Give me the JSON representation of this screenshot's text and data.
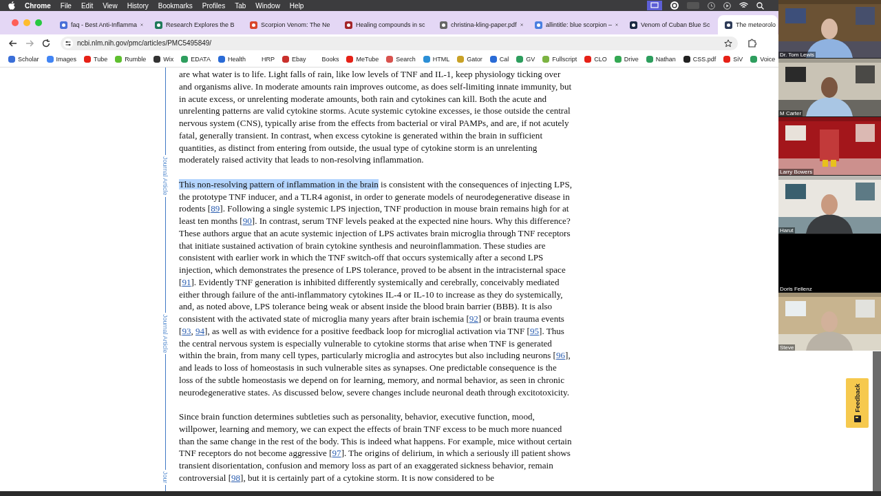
{
  "menu_bar": {
    "app": "Chrome",
    "items": [
      "File",
      "Edit",
      "View",
      "History",
      "Bookmarks",
      "Profiles",
      "Tab",
      "Window",
      "Help"
    ]
  },
  "tabs": [
    {
      "title": "faq - Best Anti-Inflamma",
      "selected": false
    },
    {
      "title": "Research Explores the B",
      "selected": false
    },
    {
      "title": "Scorpion Venom: The Ne",
      "selected": false
    },
    {
      "title": "Healing compounds in sc",
      "selected": false
    },
    {
      "title": "christina-kling-paper.pdf",
      "selected": false
    },
    {
      "title": "allintitle: blue scorpion –",
      "selected": false
    },
    {
      "title": "Venom of Cuban Blue Sc",
      "selected": false
    },
    {
      "title": "The meteorolo",
      "selected": true
    }
  ],
  "address_bar": {
    "url": "ncbi.nlm.nih.gov/pmc/articles/PMC5495849/"
  },
  "bookmarks": [
    {
      "label": "Scholar",
      "kind": "icon"
    },
    {
      "label": "Images",
      "kind": "icon"
    },
    {
      "label": "Tube",
      "kind": "icon"
    },
    {
      "label": "Rumble",
      "kind": "icon"
    },
    {
      "label": "Wix",
      "kind": "icon"
    },
    {
      "label": "EDATA",
      "kind": "icon"
    },
    {
      "label": "Health",
      "kind": "icon"
    },
    {
      "label": "HRP",
      "kind": "plain"
    },
    {
      "label": "Ebay",
      "kind": "icon"
    },
    {
      "label": "Books",
      "kind": "plain"
    },
    {
      "label": "MeTube",
      "kind": "icon"
    },
    {
      "label": "Search",
      "kind": "icon"
    },
    {
      "label": "HTML",
      "kind": "icon"
    },
    {
      "label": "Gator",
      "kind": "icon"
    },
    {
      "label": "Cal",
      "kind": "icon"
    },
    {
      "label": "GV",
      "kind": "icon"
    },
    {
      "label": "Fullscript",
      "kind": "icon"
    },
    {
      "label": "CLO",
      "kind": "icon"
    },
    {
      "label": "Drive",
      "kind": "icon"
    },
    {
      "label": "Nathan",
      "kind": "icon"
    },
    {
      "label": "CSS.pdf",
      "kind": "icon"
    },
    {
      "label": "SiV",
      "kind": "icon"
    },
    {
      "label": "Voice",
      "kind": "icon"
    }
  ],
  "margin_labels": [
    "Journal Article",
    "Journal Article",
    "Jour"
  ],
  "article": {
    "paragraphs": [
      {
        "parts": [
          {
            "kind": "text",
            "text": "are what water is to life. Light falls of rain, like low levels of TNF and IL-1, keep physiology ticking over and organisms alive. In moderate amounts rain improves outcome, as does self-limiting innate immunity, but in acute excess, or unrelenting moderate amounts, both rain and cytokines can kill. Both the acute and unrelenting patterns are valid cytokine storms. Acute systemic cytokine excesses, ie those outside the central nervous system (CNS), typically arise from the effects from bacterial or viral PAMPs, and are, if not acutely fatal, generally transient. In contrast, when excess cytokine is generated within the brain in sufficient quantities, as distinct from entering from outside, the usual type of cytokine storm is an unrelenting moderately raised activity that leads to non-resolving inflammation."
          }
        ]
      },
      {
        "parts": [
          {
            "kind": "selected",
            "text": "This non-resolving pattern of inflammation in the brain"
          },
          {
            "kind": "text",
            "text": " is consistent with the consequences of injecting LPS, the prototype TNF inducer, and a TLR4 agonist, in order to generate models of neurodegenerative disease in rodents ["
          },
          {
            "kind": "link",
            "text": "89"
          },
          {
            "kind": "text",
            "text": "]. Following a single systemic LPS injection, TNF production in mouse brain remains high for at least ten months ["
          },
          {
            "kind": "link",
            "text": "90"
          },
          {
            "kind": "text",
            "text": "]. In contrast, serum TNF levels peaked at the expected nine hours. Why this difference? These authors argue that an acute systemic injection of LPS activates brain microglia through TNF receptors that initiate sustained activation of brain cytokine synthesis and neuroinflammation. These studies are consistent with earlier work in which the TNF switch-off that occurs systemically after a second LPS injection, which demonstrates the presence of LPS tolerance, proved to be absent in the intracisternal space ["
          },
          {
            "kind": "link",
            "text": "91"
          },
          {
            "kind": "text",
            "text": "]. Evidently TNF generation is inhibited differently systemically and cerebrally, conceivably mediated either through failure of the anti-inflammatory cytokines IL-4 or IL-10 to increase as they do systemically, and, as noted above, LPS tolerance being weak or absent inside the blood brain barrier (BBB). It is also consistent with the activated state of microglia many years after brain ischemia ["
          },
          {
            "kind": "link",
            "text": "92"
          },
          {
            "kind": "text",
            "text": "] or brain trauma events ["
          },
          {
            "kind": "link",
            "text": "93"
          },
          {
            "kind": "text",
            "text": ", "
          },
          {
            "kind": "link",
            "text": "94"
          },
          {
            "kind": "text",
            "text": "], as well as with evidence for a positive feedback loop for microglial activation via TNF ["
          },
          {
            "kind": "link",
            "text": "95"
          },
          {
            "kind": "text",
            "text": "]. Thus the central nervous system is especially vulnerable to cytokine storms that arise when TNF is generated within the brain, from many cell types, particularly microglia and astrocytes but also including neurons ["
          },
          {
            "kind": "link",
            "text": "96"
          },
          {
            "kind": "text",
            "text": "], and leads to loss of homeostasis in such vulnerable sites as synapses. One predictable consequence is the loss of the subtle homeostasis we depend on for learning, memory, and normal behavior, as seen in chronic neurodegenerative states. As discussed below, severe changes include neuronal death through excitotoxicity."
          }
        ]
      },
      {
        "parts": [
          {
            "kind": "text",
            "text": "Since brain function determines subtleties such as personality, behavior, executive function, mood, willpower, learning and memory, we can expect the effects of brain TNF excess to be much more nuanced than the same change in the rest of the body. This is indeed what happens. For example, mice without certain TNF receptors do not become aggressive ["
          },
          {
            "kind": "link",
            "text": "97"
          },
          {
            "kind": "text",
            "text": "]. The origins of delirium, in which a seriously ill patient shows transient disorientation, confusion and memory loss as part of an exaggerated sickness behavior, remain controversial ["
          },
          {
            "kind": "link",
            "text": "98"
          },
          {
            "kind": "text",
            "text": "], but it is certainly part of a cytokine storm. It is now considered to be"
          }
        ]
      }
    ]
  },
  "video_call": {
    "participants": [
      {
        "name": "Dr. Tom Lewis",
        "kind": "video"
      },
      {
        "name": "M Carter",
        "kind": "video"
      },
      {
        "name": "Larry Bowers",
        "kind": "video"
      },
      {
        "name": "Harut",
        "kind": "video"
      },
      {
        "name": "Doris Fellenz",
        "kind": "blank"
      },
      {
        "name": "Steve",
        "kind": "video"
      }
    ]
  },
  "feedback_button": {
    "label": "Feedback"
  }
}
